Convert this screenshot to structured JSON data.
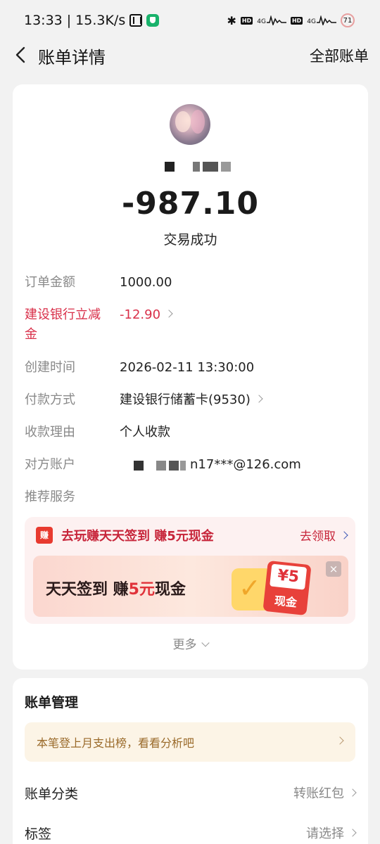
{
  "status_bar": {
    "time": "13:33",
    "speed": "15.3K/s",
    "net1": "4G",
    "net2": "4G",
    "battery": "71"
  },
  "header": {
    "title": "账单详情",
    "all_bills": "全部账单"
  },
  "transaction": {
    "amount": "-987.10",
    "status": "交易成功"
  },
  "details": {
    "order_amount": {
      "label": "订单金额",
      "value": "1000.00"
    },
    "discount": {
      "label": "建设银行立减金",
      "value": "-12.90"
    },
    "created": {
      "label": "创建时间",
      "value": "2026-02-11 13:30:00"
    },
    "payment": {
      "label": "付款方式",
      "value": "建设银行储蓄卡(9530)"
    },
    "reason": {
      "label": "收款理由",
      "value": "个人收款"
    },
    "account": {
      "label": "对方账户",
      "value": "n17***@126.com"
    },
    "recommend": {
      "label": "推荐服务"
    }
  },
  "promo": {
    "icon_text": "赚",
    "text": "去玩赚天天签到 赚5元现金",
    "link": "去领取",
    "banner_prefix": "天天签到 赚",
    "banner_highlight": "5元",
    "banner_suffix": "现金",
    "cash_num": "¥5",
    "cash_word": "现金",
    "close": "×"
  },
  "more": "更多",
  "manage": {
    "title": "账单管理",
    "insight": "本笔登上月支出榜，看看分析吧",
    "category": {
      "label": "账单分类",
      "value": "转账红包"
    },
    "tag": {
      "label": "标签",
      "value": "请选择"
    }
  }
}
